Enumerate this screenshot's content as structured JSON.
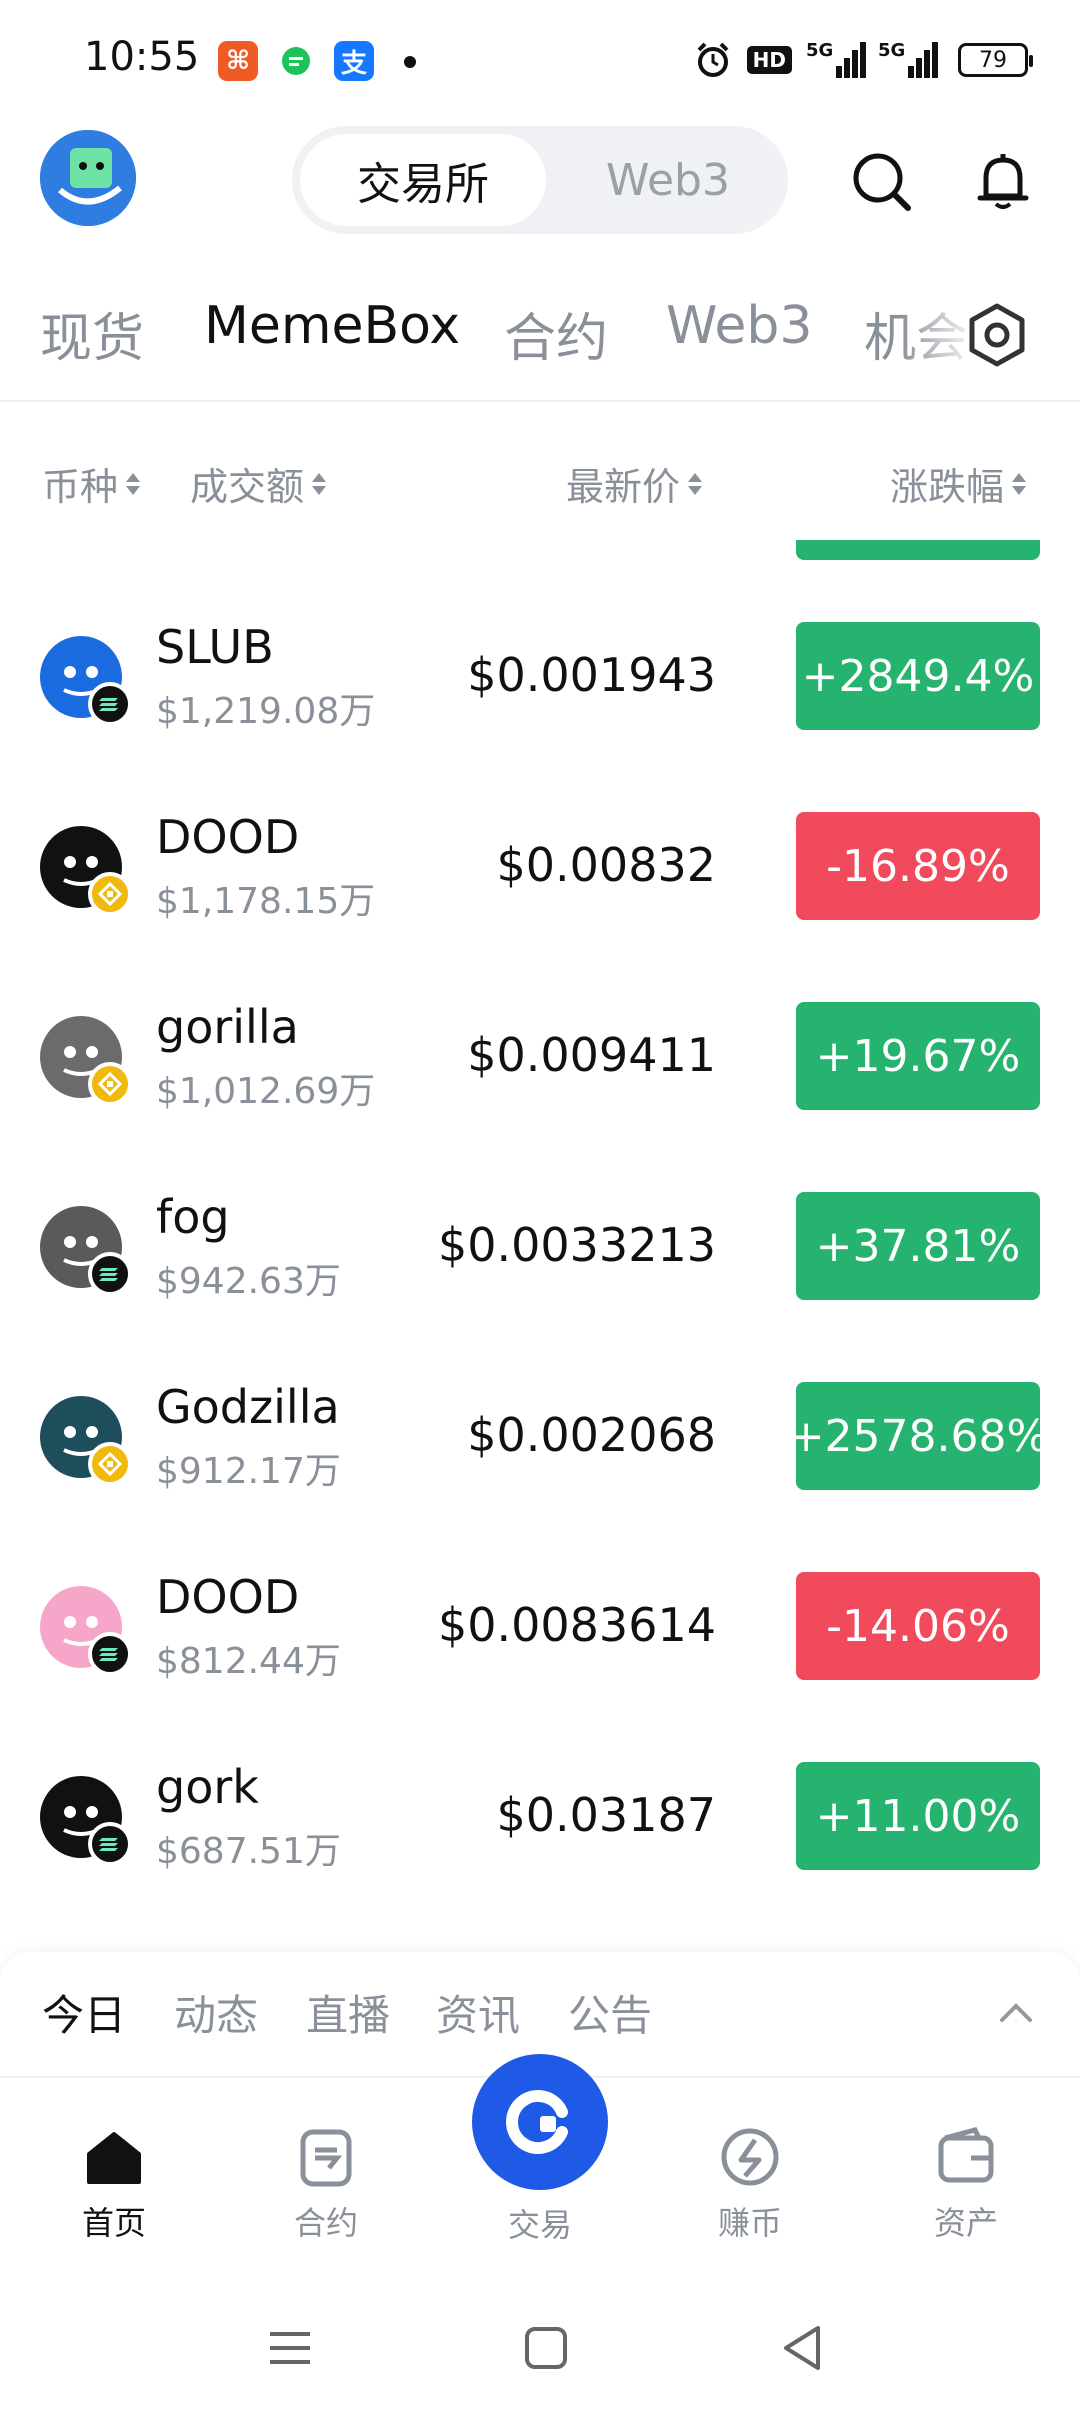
{
  "status_bar": {
    "time": "10:55",
    "battery": "79",
    "hd": "HD",
    "net1": "5G",
    "net2": "5G"
  },
  "header": {
    "segment_active": "交易所",
    "segment_other": "Web3"
  },
  "categories": [
    "现货",
    "MemeBox",
    "合约",
    "Web3",
    "机会"
  ],
  "columns": {
    "coin": "币种",
    "volume": "成交额",
    "price": "最新价",
    "change": "涨跌幅"
  },
  "rows": [
    {
      "name": "SLUB",
      "volume": "$1,219.08万",
      "price": "$0.001943",
      "change": "+2849.4%",
      "direction": "up",
      "chain": "sol",
      "avatar_color": "#1b6be0"
    },
    {
      "name": "DOOD",
      "volume": "$1,178.15万",
      "price": "$0.00832",
      "change": "-16.89%",
      "direction": "down",
      "chain": "bnb",
      "avatar_color": "#111111"
    },
    {
      "name": "gorilla",
      "volume": "$1,012.69万",
      "price": "$0.009411",
      "change": "+19.67%",
      "direction": "up",
      "chain": "bnb",
      "avatar_color": "#6b6b6b"
    },
    {
      "name": "fog",
      "volume": "$942.63万",
      "price": "$0.0033213",
      "change": "+37.81%",
      "direction": "up",
      "chain": "sol",
      "avatar_color": "#5a5a5a"
    },
    {
      "name": "Godzilla",
      "volume": "$912.17万",
      "price": "$0.002068",
      "change": "+2578.68%",
      "direction": "up",
      "chain": "bnb",
      "avatar_color": "#1e4d5c"
    },
    {
      "name": "DOOD",
      "volume": "$812.44万",
      "price": "$0.0083614",
      "change": "-14.06%",
      "direction": "down",
      "chain": "sol",
      "avatar_color": "#f6a7c9"
    },
    {
      "name": "gork",
      "volume": "$687.51万",
      "price": "$0.03187",
      "change": "+11.00%",
      "direction": "up",
      "chain": "sol",
      "avatar_color": "#111111"
    }
  ],
  "news_tabs": [
    "今日",
    "动态",
    "直播",
    "资讯",
    "公告"
  ],
  "nav": {
    "home": "首页",
    "futures": "合约",
    "trade": "交易",
    "earn": "赚币",
    "assets": "资产"
  },
  "colors": {
    "up": "#25b36f",
    "down": "#f04a5c",
    "brand": "#1f5ae6"
  }
}
